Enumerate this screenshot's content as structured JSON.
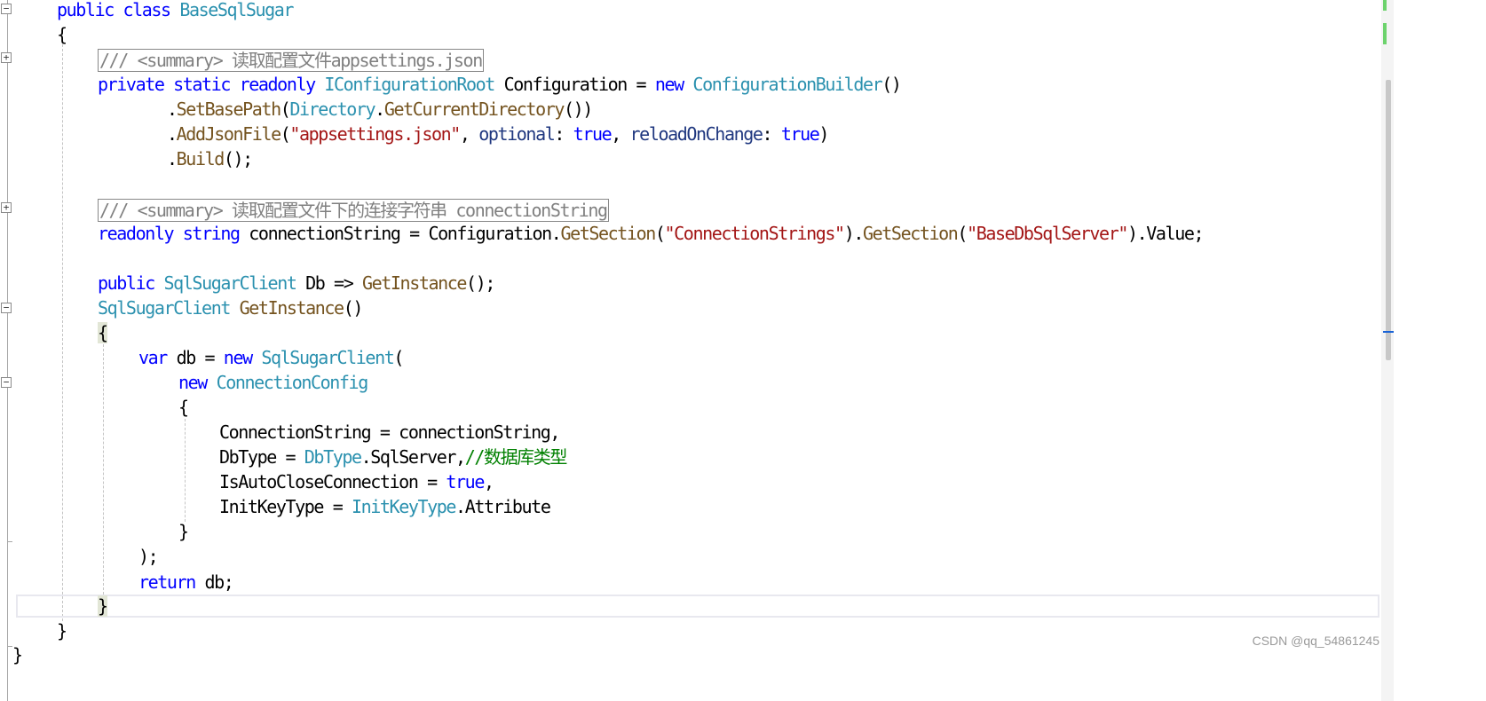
{
  "colors": {
    "keyword": "#0000ff",
    "type": "#2b91af",
    "method": "#74531f",
    "string": "#a31515",
    "comment": "#008000",
    "collapsed_comment": "#808080",
    "brace_highlight": "#e2e6d6"
  },
  "code": {
    "line1": {
      "kw": "public class ",
      "type": "BaseSqlSugar"
    },
    "line2": {
      "brace": "{"
    },
    "line3": {
      "collapsed": "/// <summary> 读取配置文件appsettings.json"
    },
    "line4": {
      "kw1": "private static readonly ",
      "type1": "IConfigurationRoot",
      "plain1": " Configuration = ",
      "kw2": "new ",
      "type2": "ConfigurationBuilder",
      "plain2": "()"
    },
    "line5": {
      "dot": ".",
      "method": "SetBasePath",
      "p1": "(",
      "type": "Directory",
      "p2": ".",
      "method2": "GetCurrentDirectory",
      "p3": "())"
    },
    "line6": {
      "dot": ".",
      "method": "AddJsonFile",
      "p1": "(",
      "str": "\"appsettings.json\"",
      "p2": ", ",
      "param1": "optional",
      "p3": ": ",
      "kw1": "true",
      "p4": ", ",
      "param2": "reloadOnChange",
      "p5": ": ",
      "kw2": "true",
      "p6": ")"
    },
    "line7": {
      "dot": ".",
      "method": "Build",
      "p1": "();"
    },
    "line8": {
      "collapsed": "/// <summary> 读取配置文件下的连接字符串 connectionString"
    },
    "line9": {
      "kw1": "readonly ",
      "kw2": "string",
      "plain1": " connectionString = Configuration.",
      "method1": "GetSection",
      "p1": "(",
      "str1": "\"ConnectionStrings\"",
      "p2": ").",
      "method2": "GetSection",
      "p3": "(",
      "str2": "\"BaseDbSqlServer\"",
      "p4": ").Value;"
    },
    "line10": {
      "kw": "public ",
      "type": "SqlSugarClient",
      "plain": " Db => ",
      "method": "GetInstance",
      "p1": "();"
    },
    "line11": {
      "type": "SqlSugarClient",
      "plain": " ",
      "method": "GetInstance",
      "p1": "()"
    },
    "line12": {
      "brace": "{"
    },
    "line13": {
      "kw1": "var",
      "plain1": " db = ",
      "kw2": "new ",
      "type": "SqlSugarClient",
      "p1": "("
    },
    "line14": {
      "kw": "new ",
      "type": "ConnectionConfig"
    },
    "line15": {
      "brace": "{"
    },
    "line16": {
      "plain": "ConnectionString = connectionString,"
    },
    "line17": {
      "plain1": "DbType = ",
      "type": "DbType",
      "plain2": ".SqlServer,",
      "comment": "//数据库类型"
    },
    "line18": {
      "plain1": "IsAutoCloseConnection = ",
      "kw": "true",
      "plain2": ","
    },
    "line19": {
      "plain1": "InitKeyType = ",
      "type": "InitKeyType",
      "plain2": ".Attribute"
    },
    "line20": {
      "brace": "}"
    },
    "line21": {
      "plain": ");"
    },
    "line22": {
      "kw": "return",
      "plain": " db;"
    },
    "line23": {
      "brace": "}"
    },
    "line24": {
      "brace": "}"
    },
    "line25": {
      "brace": "}"
    }
  },
  "fold_markers": {
    "minus": "−",
    "plus": "+"
  },
  "watermark": "CSDN @qq_54861245"
}
